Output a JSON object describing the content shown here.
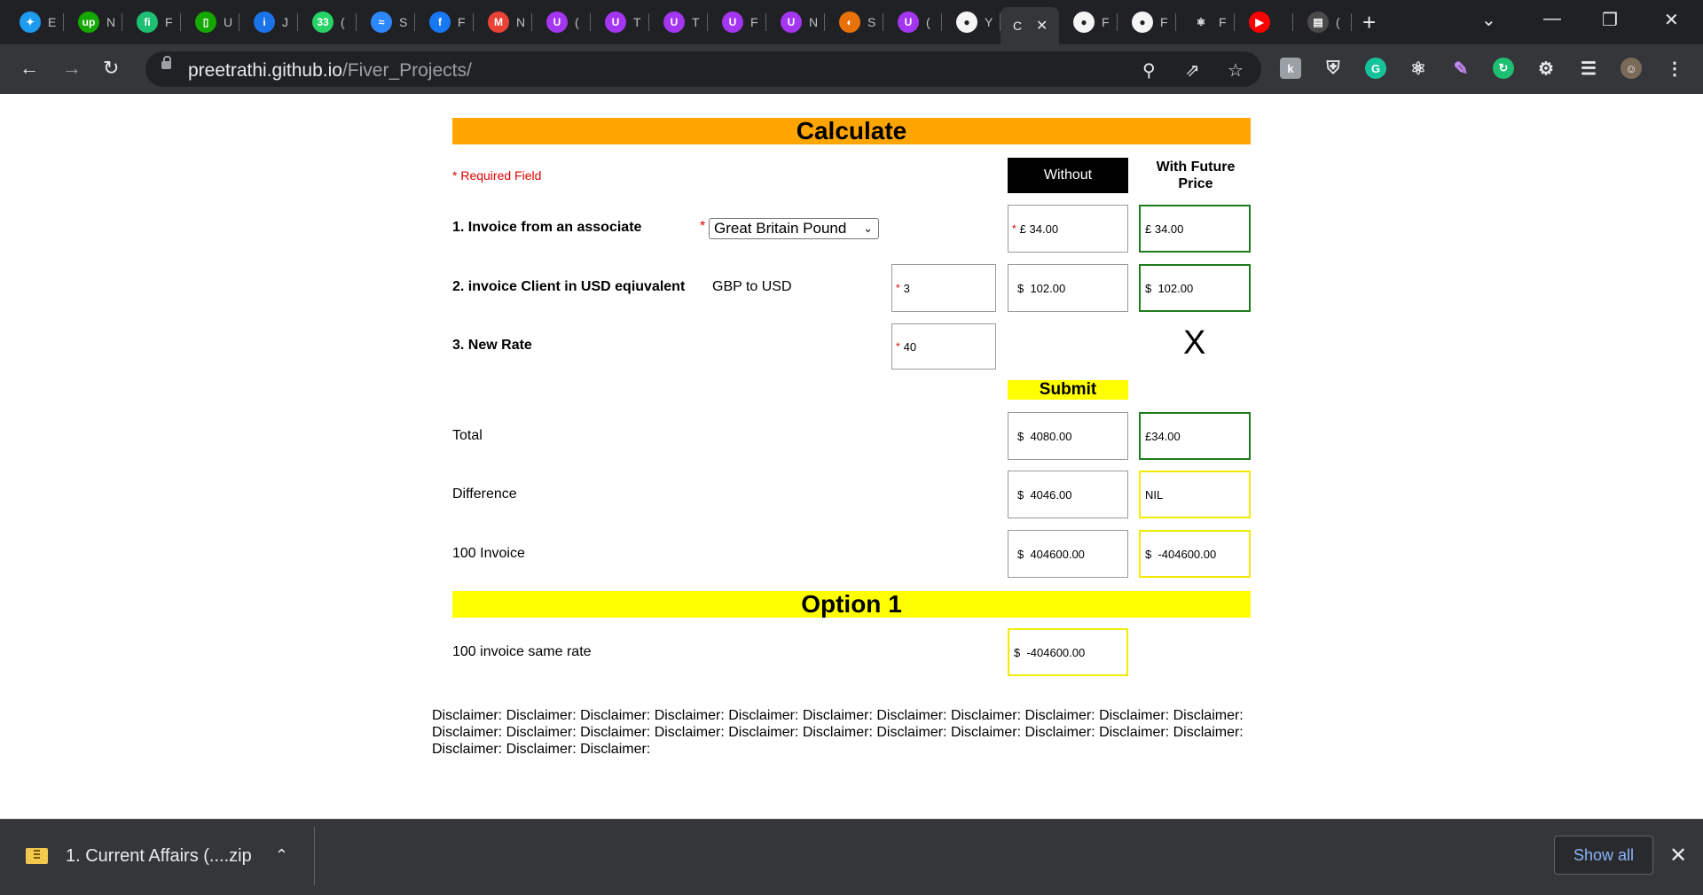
{
  "browser": {
    "tabs": [
      {
        "icon": "twitter-icon",
        "title": "E",
        "color": "#1d9bf0",
        "glyph": "✦"
      },
      {
        "icon": "upwork-icon",
        "title": "N",
        "color": "#14a800",
        "glyph": "up"
      },
      {
        "icon": "fiverr-icon",
        "title": "F",
        "color": "#1dbf73",
        "glyph": "fi"
      },
      {
        "icon": "device-icon",
        "title": "U",
        "color": "#14a800",
        "glyph": "▯"
      },
      {
        "icon": "info-icon",
        "title": "J",
        "color": "#1a73e8",
        "glyph": "i"
      },
      {
        "icon": "whatsapp-icon",
        "title": "(",
        "color": "#25d366",
        "glyph": "33"
      },
      {
        "icon": "messenger-icon",
        "title": "S",
        "color": "#2d88ff",
        "glyph": "≈"
      },
      {
        "icon": "facebook-icon",
        "title": "F",
        "color": "#1877f2",
        "glyph": "f"
      },
      {
        "icon": "gmail-icon",
        "title": "N",
        "color": "#ea4335",
        "glyph": "M"
      },
      {
        "icon": "udemy-icon",
        "title": "(",
        "color": "#a435f0",
        "glyph": "U"
      },
      {
        "icon": "udemy-icon",
        "title": "T",
        "color": "#a435f0",
        "glyph": "U"
      },
      {
        "icon": "udemy-icon",
        "title": "T",
        "color": "#a435f0",
        "glyph": "U"
      },
      {
        "icon": "udemy-icon",
        "title": "F",
        "color": "#a435f0",
        "glyph": "U"
      },
      {
        "icon": "udemy-icon",
        "title": "N",
        "color": "#a435f0",
        "glyph": "U"
      },
      {
        "icon": "orange-app-icon",
        "title": "S",
        "color": "#e8710a",
        "glyph": "◐"
      },
      {
        "icon": "udemy-icon",
        "title": "(",
        "color": "#a435f0",
        "glyph": "U"
      },
      {
        "icon": "github-icon",
        "title": "Y",
        "color": "#f5f5f5",
        "glyph": "●"
      },
      {
        "icon": "",
        "title": "C",
        "color": "#35363a",
        "glyph": "",
        "active": true
      },
      {
        "icon": "github-icon",
        "title": "F",
        "color": "#f5f5f5",
        "glyph": "●"
      },
      {
        "icon": "github-icon",
        "title": "F",
        "color": "#f5f5f5",
        "glyph": "●"
      },
      {
        "icon": "react-icon",
        "title": "F",
        "color": "#202124",
        "glyph": "⚛"
      },
      {
        "icon": "youtube-icon",
        "title": "",
        "color": "#ff0000",
        "glyph": "▶"
      },
      {
        "icon": "docs-icon",
        "title": "(",
        "color": "#4a4a4a",
        "glyph": "▤"
      }
    ],
    "url_domain": "preetrathi.github.io",
    "url_path": "/Fiver_Projects/"
  },
  "calc": {
    "title": "Calculate",
    "required_note": "* Required Field",
    "col_without": "Without",
    "col_future": "With Future Price",
    "row1": {
      "label": "1. Invoice from an associate",
      "currency": "Great Britain Pound",
      "without": "£ 34.00",
      "future": "£ 34.00"
    },
    "row2": {
      "label": "2. invoice Client in USD eqiuvalent",
      "pair": "GBP to USD",
      "rate": "3",
      "without": "$  102.00",
      "future": "$  102.00"
    },
    "row3": {
      "label": "3. New Rate",
      "rate": "40",
      "future_mark": "X"
    },
    "submit": "Submit",
    "total": {
      "label": "Total",
      "without": "$  4080.00",
      "future": "£34.00"
    },
    "difference": {
      "label": "Difference",
      "without": "$  4046.00",
      "future": "NIL"
    },
    "invoice100": {
      "label": "100 Invoice",
      "without": "$  404600.00",
      "future": "$  -404600.00"
    },
    "option1": {
      "title": "Option 1",
      "label": "100 invoice same rate",
      "value": "$  -404600.00"
    },
    "disclaimer": "Disclaimer: Disclaimer: Disclaimer: Disclaimer: Disclaimer: Disclaimer: Disclaimer: Disclaimer: Disclaimer: Disclaimer: Disclaimer: Disclaimer: Disclaimer: Disclaimer: Disclaimer: Disclaimer: Disclaimer: Disclaimer: Disclaimer: Disclaimer: Disclaimer: Disclaimer: Disclaimer: Disclaimer: Disclaimer:"
  },
  "downloads": {
    "file": "1. Current Affairs (....zip",
    "show_all": "Show all"
  },
  "colors": {
    "orange_bar": "#ffa500",
    "yellow": "#ffff00",
    "green_border": "#1f7a1f",
    "required_red": "#e00000"
  }
}
